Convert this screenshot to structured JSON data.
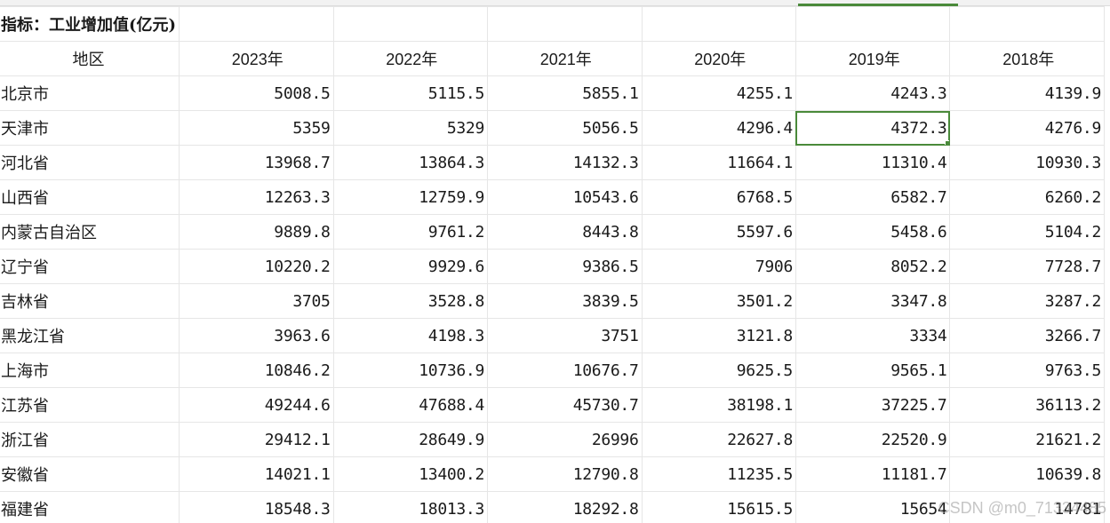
{
  "sheet": {
    "title": "指标：工业增加值(亿元)",
    "header_region": "地区",
    "years": [
      "2023年",
      "2022年",
      "2021年",
      "2020年",
      "2019年",
      "2018年"
    ],
    "rows": [
      {
        "region": "北京市",
        "values": [
          "5008.5",
          "5115.5",
          "5855.1",
          "4255.1",
          "4243.3",
          "4139.9"
        ]
      },
      {
        "region": "天津市",
        "values": [
          "5359",
          "5329",
          "5056.5",
          "4296.4",
          "4372.3",
          "4276.9"
        ]
      },
      {
        "region": "河北省",
        "values": [
          "13968.7",
          "13864.3",
          "14132.3",
          "11664.1",
          "11310.4",
          "10930.3"
        ]
      },
      {
        "region": "山西省",
        "values": [
          "12263.3",
          "12759.9",
          "10543.6",
          "6768.5",
          "6582.7",
          "6260.2"
        ]
      },
      {
        "region": "内蒙古自治区",
        "values": [
          "9889.8",
          "9761.2",
          "8443.8",
          "5597.6",
          "5458.6",
          "5104.2"
        ]
      },
      {
        "region": "辽宁省",
        "values": [
          "10220.2",
          "9929.6",
          "9386.5",
          "7906",
          "8052.2",
          "7728.7"
        ]
      },
      {
        "region": "吉林省",
        "values": [
          "3705",
          "3528.8",
          "3839.5",
          "3501.2",
          "3347.8",
          "3287.2"
        ]
      },
      {
        "region": "黑龙江省",
        "values": [
          "3963.6",
          "4198.3",
          "3751",
          "3121.8",
          "3334",
          "3266.7"
        ]
      },
      {
        "region": "上海市",
        "values": [
          "10846.2",
          "10736.9",
          "10676.7",
          "9625.5",
          "9565.1",
          "9763.5"
        ]
      },
      {
        "region": "江苏省",
        "values": [
          "49244.6",
          "47688.4",
          "45730.7",
          "38198.1",
          "37225.7",
          "36113.2"
        ]
      },
      {
        "region": "浙江省",
        "values": [
          "29412.1",
          "28649.9",
          "26996",
          "22627.8",
          "22520.9",
          "21621.2"
        ]
      },
      {
        "region": "安徽省",
        "values": [
          "14021.1",
          "13400.2",
          "12790.8",
          "11235.5",
          "11181.7",
          "10639.8"
        ]
      },
      {
        "region": "福建省",
        "values": [
          "18548.3",
          "18013.3",
          "18292.8",
          "15615.5",
          "15654",
          "14781"
        ]
      }
    ],
    "selected_row_index": 1,
    "selected_col_index": 4,
    "accent_color": "#4a8a3a"
  },
  "watermark": "CSDN @m0_71334485"
}
